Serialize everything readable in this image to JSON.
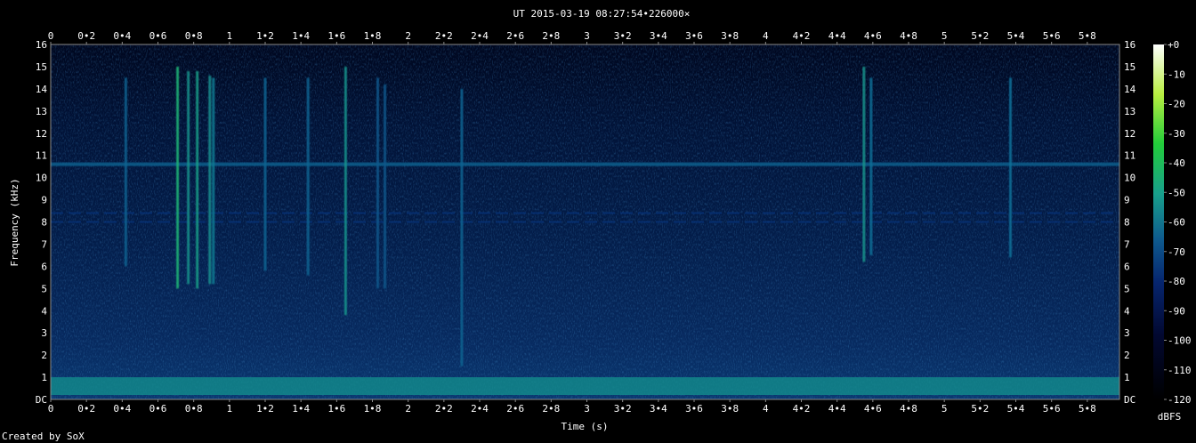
{
  "chart_data": {
    "type": "heatmap",
    "title": "UT 2015-03-19 08:27:54•226000×",
    "xlabel": "Time (s)",
    "ylabel": "Frequency (kHz)",
    "xlim": [
      0,
      5.98
    ],
    "ylim": [
      0,
      16
    ],
    "x_ticks": [
      "0",
      "0•2",
      "0•4",
      "0•6",
      "0•8",
      "1",
      "1•2",
      "1•4",
      "1•6",
      "1•8",
      "2",
      "2•2",
      "2•4",
      "2•6",
      "2•8",
      "3",
      "3•2",
      "3•4",
      "3•6",
      "3•8",
      "4",
      "4•2",
      "4•4",
      "4•6",
      "4•8",
      "5",
      "5•2",
      "5•4",
      "5•6",
      "5•8"
    ],
    "y_ticks": [
      "DC",
      "1",
      "2",
      "3",
      "4",
      "5",
      "6",
      "7",
      "8",
      "9",
      "10",
      "11",
      "12",
      "13",
      "14",
      "15",
      "16"
    ],
    "colorbar": {
      "label": "dBFS",
      "ticks": [
        "+0",
        "-10",
        "-20",
        "-30",
        "-40",
        "-50",
        "-60",
        "-70",
        "-80",
        "-90",
        "-100",
        "-110",
        "-120"
      ],
      "range": [
        -120,
        0
      ]
    },
    "background_level_dbfs": -100,
    "features": {
      "low_band": {
        "f_range_khz": [
          0.2,
          1.0
        ],
        "level_dbfs": -75
      },
      "tone": {
        "f_khz": 10.6,
        "level_dbfs": -82
      },
      "dashed_tones": [
        {
          "f_khz": 8.4,
          "level_dbfs": -90
        },
        {
          "f_khz": 8.0,
          "level_dbfs": -90
        }
      ],
      "vertical_bursts": [
        {
          "t": 0.42,
          "f_range_khz": [
            6,
            14.5
          ],
          "level_dbfs": -82
        },
        {
          "t": 0.71,
          "f_range_khz": [
            5,
            15
          ],
          "level_dbfs": -68
        },
        {
          "t": 0.77,
          "f_range_khz": [
            5.2,
            14.8
          ],
          "level_dbfs": -74
        },
        {
          "t": 0.82,
          "f_range_khz": [
            5,
            14.8
          ],
          "level_dbfs": -72
        },
        {
          "t": 0.89,
          "f_range_khz": [
            5.2,
            14.6
          ],
          "level_dbfs": -75
        },
        {
          "t": 0.91,
          "f_range_khz": [
            5.2,
            14.5
          ],
          "level_dbfs": -78
        },
        {
          "t": 1.2,
          "f_range_khz": [
            5.8,
            14.5
          ],
          "level_dbfs": -82
        },
        {
          "t": 1.44,
          "f_range_khz": [
            5.6,
            14.5
          ],
          "level_dbfs": -82
        },
        {
          "t": 1.65,
          "f_range_khz": [
            3.8,
            15
          ],
          "level_dbfs": -74
        },
        {
          "t": 1.83,
          "f_range_khz": [
            5,
            14.5
          ],
          "level_dbfs": -84
        },
        {
          "t": 1.87,
          "f_range_khz": [
            5,
            14.2
          ],
          "level_dbfs": -84
        },
        {
          "t": 2.3,
          "f_range_khz": [
            1.5,
            14
          ],
          "level_dbfs": -82
        },
        {
          "t": 4.55,
          "f_range_khz": [
            6.2,
            15
          ],
          "level_dbfs": -74
        },
        {
          "t": 4.59,
          "f_range_khz": [
            6.5,
            14.5
          ],
          "level_dbfs": -80
        },
        {
          "t": 5.37,
          "f_range_khz": [
            6.4,
            14.5
          ],
          "level_dbfs": -80
        }
      ]
    }
  },
  "footer": {
    "credit": "Created by SoX"
  }
}
